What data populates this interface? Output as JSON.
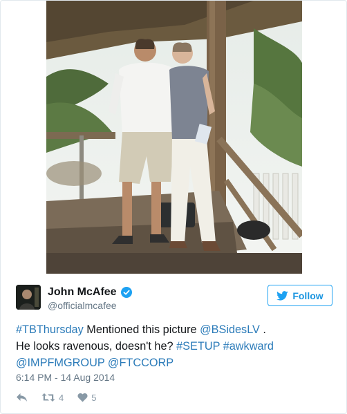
{
  "colors": {
    "link": "#2b7bb9",
    "follow_border": "#1da1f2",
    "verified": "#1da1f2",
    "secondary_text": "#657786",
    "action_icon": "#8899a6"
  },
  "media": {
    "icon": "photo-of-two-men-on-porch"
  },
  "author": {
    "name": "John McAfee",
    "handle": "@officialmcafee",
    "verified_icon": "verified-badge-icon",
    "avatar_icon": "avatar-portrait"
  },
  "follow": {
    "label": "Follow",
    "icon": "bird-icon"
  },
  "tweet": {
    "segments": {
      "hashtag_tbthursday": "#TBThursday",
      "text_1": " Mentioned this picture ",
      "mention_bsideslv": "@BSidesLV",
      "text_2": " .",
      "text_3": "He looks ravenous, doesn't he? ",
      "hashtag_setup": "#SETUP",
      "text_4": " ",
      "hashtag_awkward": "#awkward",
      "mention_impfmgroup": "@IMPFMGROUP",
      "text_5": " ",
      "mention_ftccorp": "@FTCCORP"
    }
  },
  "timestamp": "6:14 PM - 14 Aug 2014",
  "actions": {
    "reply_icon": "reply-icon",
    "retweet_icon": "retweet-icon",
    "retweet_count": "4",
    "like_icon": "heart-icon",
    "like_count": "5"
  }
}
